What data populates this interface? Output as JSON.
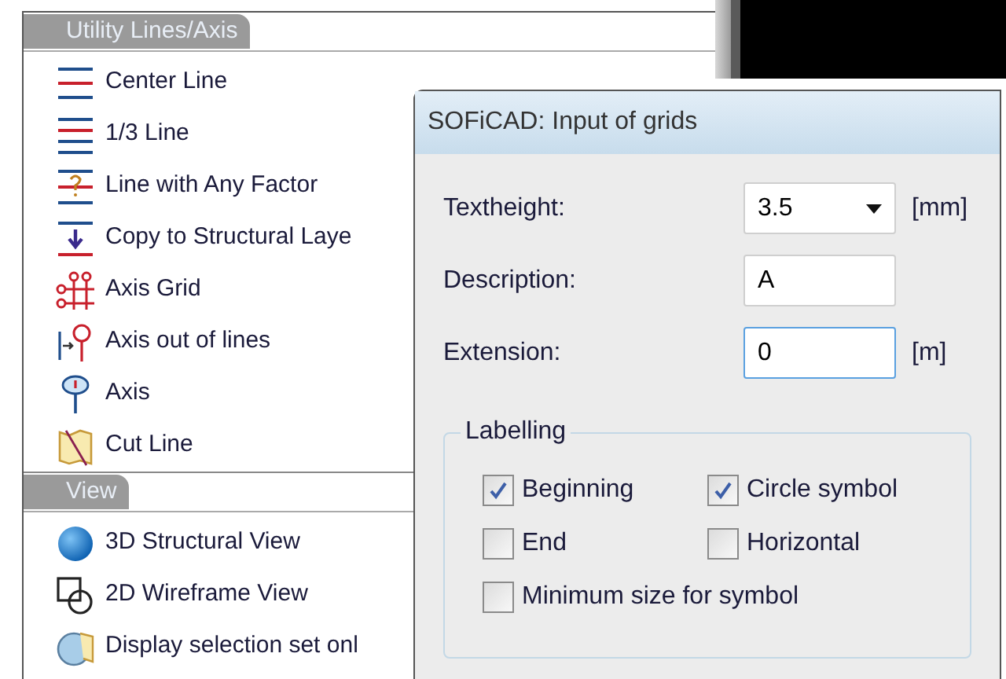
{
  "palette": {
    "sections": [
      {
        "title": "Utility Lines/Axis",
        "items": [
          {
            "label": "Center Line",
            "kind": "center"
          },
          {
            "label": "1/3 Line",
            "kind": "third"
          },
          {
            "label": "Line with Any Factor",
            "kind": "factor"
          },
          {
            "label": "Copy to Structural Laye",
            "kind": "copy"
          },
          {
            "label": "Axis Grid",
            "kind": "grid"
          },
          {
            "label": "Axis out of lines",
            "kind": "axisout"
          },
          {
            "label": "Axis",
            "kind": "axis"
          },
          {
            "label": "Cut Line",
            "kind": "cut"
          }
        ]
      },
      {
        "title": "View",
        "items": [
          {
            "label": "3D Structural View",
            "kind": "sphere"
          },
          {
            "label": "2D Wireframe View",
            "kind": "wire"
          },
          {
            "label": "Display selection set onl",
            "kind": "display"
          }
        ]
      }
    ]
  },
  "dialog": {
    "title": "SOFiCAD: Input of grids",
    "fields": [
      {
        "kind": "combo",
        "label": "Textheight:",
        "value": "3.5",
        "unit": "[mm]",
        "focused": false
      },
      {
        "kind": "text",
        "label": "Description:",
        "value": "A",
        "focused": false
      },
      {
        "kind": "text",
        "label": "Extension:",
        "value": "0",
        "unit": "[m]",
        "focused": true
      }
    ],
    "group": {
      "title": "Labelling",
      "checkboxes": [
        {
          "label": "Beginning",
          "checked": true
        },
        {
          "label": "Circle symbol",
          "checked": true
        },
        {
          "label": "End",
          "checked": false
        },
        {
          "label": "Horizontal",
          "checked": false
        },
        {
          "label": "Minimum size for symbol",
          "checked": false
        }
      ]
    }
  }
}
